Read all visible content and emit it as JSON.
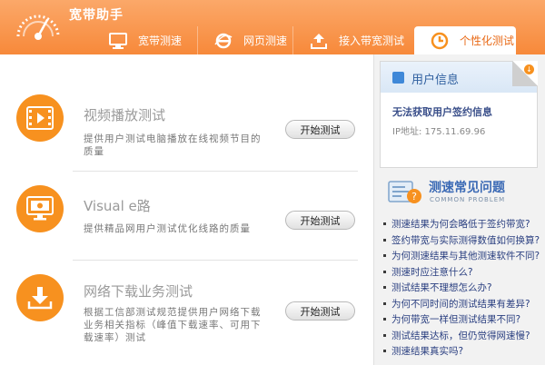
{
  "app": {
    "title": "宽带助手"
  },
  "tabs": [
    {
      "label": "宽带测速",
      "icon": "monitor-icon"
    },
    {
      "label": "网页测速",
      "icon": "ie-browser-icon"
    },
    {
      "label": "接入带宽测试",
      "icon": "upload-icon"
    },
    {
      "label": "个性化测试",
      "icon": "clock-icon",
      "active": true
    }
  ],
  "tests": [
    {
      "title": "视频播放测试",
      "desc": "提供用户测试电脑播放在线视频节目的质量",
      "button": "开始测试",
      "icon": "video-play-icon"
    },
    {
      "title": "Visual e路",
      "desc": "提供精品网用户测试优化线路的质量",
      "button": "开始测试",
      "icon": "monitor-route-icon"
    },
    {
      "title": "网络下载业务测试",
      "desc": "根据工信部测试规范提供用户网络下载业务相关指标（峰值下载速率、可用下载速率）测试",
      "button": "开始测试",
      "icon": "download-icon"
    }
  ],
  "user": {
    "title": "用户信息",
    "message": "无法获取用户签约信息",
    "ip": "IP地址: 175.11.69.96"
  },
  "faq": {
    "title": "测速常见问题",
    "subtitle": "COMMON PROBLEM",
    "items": [
      "测速结果为何会略低于签约带宽?",
      "签约带宽与实际测得数值如何换算?",
      "为何测速结果与其他测速软件不同?",
      "测速时应注意什么?",
      "测试结果不理想怎么办?",
      "为何不同时间的测试结果有差异?",
      "为何带宽一样但测试结果不同?",
      "测试结果达标，但仍觉得网速慢?",
      "测速结果真实吗?"
    ]
  },
  "colors": {
    "accent": "#f7911f",
    "header": "#f7893a",
    "link": "#2a3f80"
  }
}
